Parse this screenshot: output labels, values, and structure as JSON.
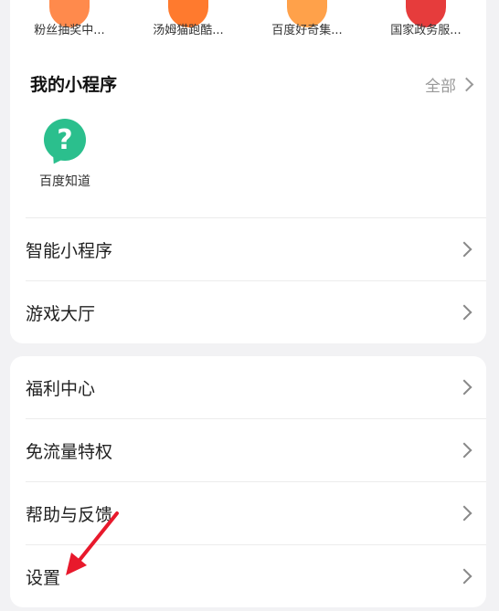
{
  "recent_programs": [
    {
      "label": "粉丝抽奖中...",
      "color": "#ff8a4c"
    },
    {
      "label": "汤姆猫跑酷...",
      "color": "#ff7a2e"
    },
    {
      "label": "百度好奇集...",
      "color": "#ffa14a"
    },
    {
      "label": "国家政务服...",
      "color": "#e63c3c"
    }
  ],
  "my_mini_programs": {
    "title": "我的小程序",
    "see_all": "全部",
    "apps": [
      {
        "label": "百度知道",
        "icon": "question-bubble-icon",
        "glyph": "?",
        "color": "#2bbf8d"
      }
    ]
  },
  "menu_top": [
    {
      "label": "智能小程序"
    },
    {
      "label": "游戏大厅"
    }
  ],
  "menu_bottom": [
    {
      "label": "福利中心"
    },
    {
      "label": "免流量特权"
    },
    {
      "label": "帮助与反馈"
    },
    {
      "label": "设置"
    }
  ],
  "annotation_color": "#e8192c"
}
